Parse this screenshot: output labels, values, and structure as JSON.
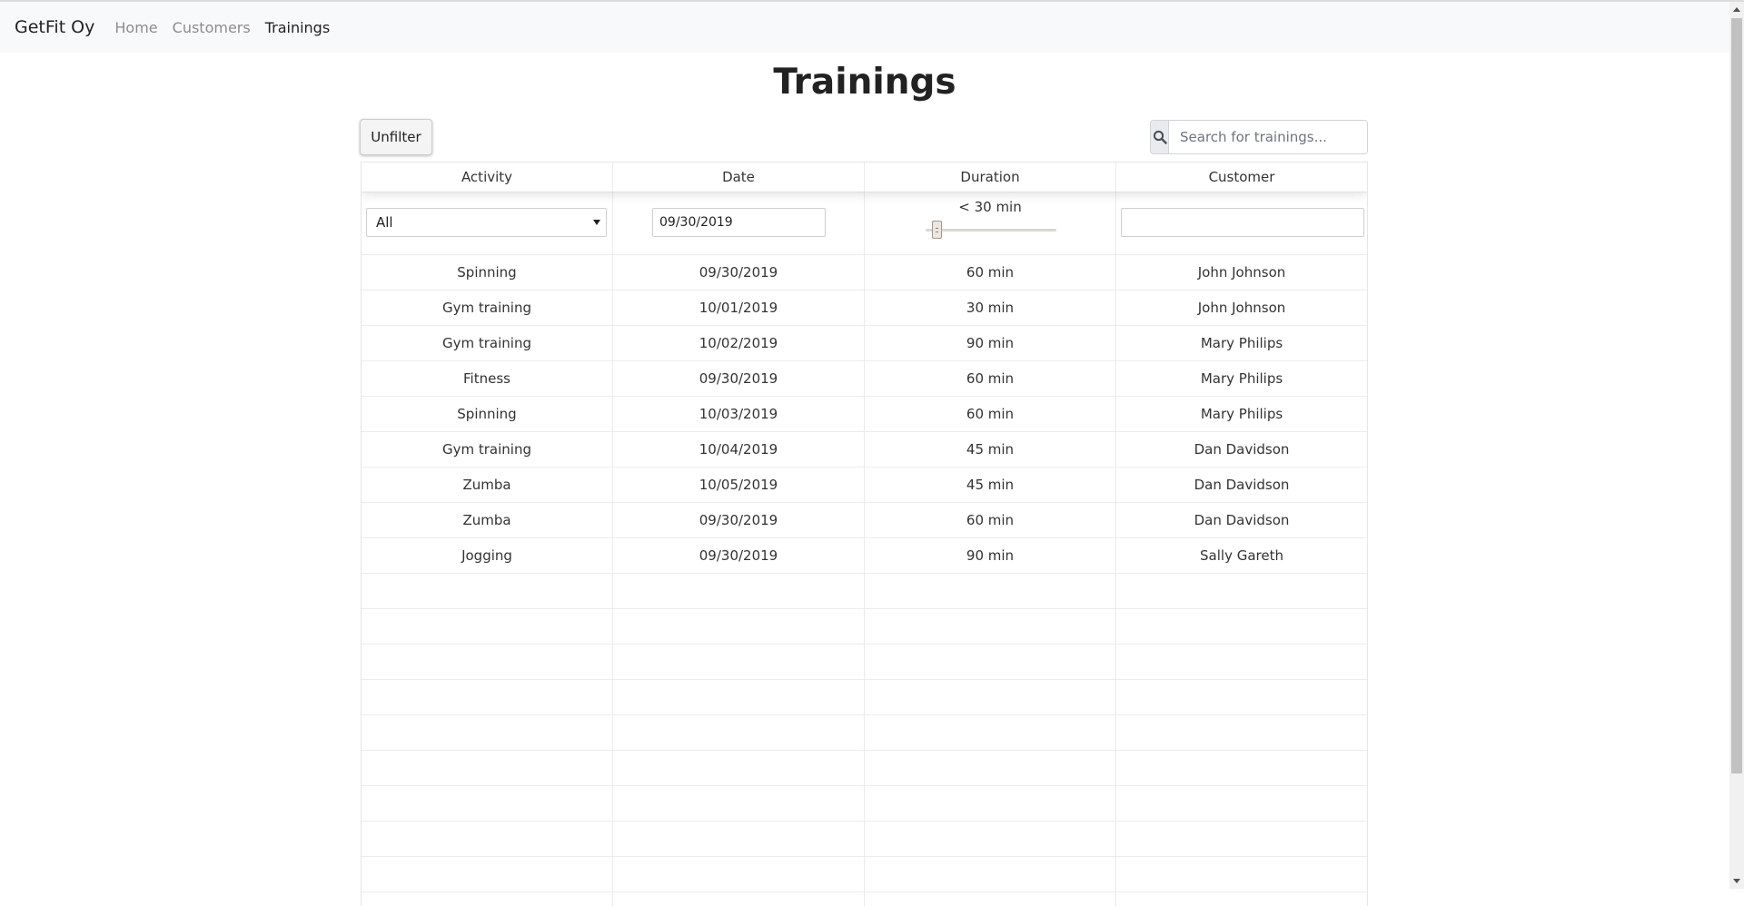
{
  "navbar": {
    "brand": "GetFit Oy",
    "links": [
      {
        "label": "Home",
        "active": false
      },
      {
        "label": "Customers",
        "active": false
      },
      {
        "label": "Trainings",
        "active": true
      }
    ]
  },
  "page": {
    "title": "Trainings"
  },
  "toolbar": {
    "unfilter_label": "Unfilter",
    "search_icon": "search-icon",
    "search_placeholder": "Search for trainings..."
  },
  "table": {
    "columns": [
      "Activity",
      "Date",
      "Duration",
      "Customer"
    ],
    "filters": {
      "activity_selected": "All",
      "date_value": "09/30/2019",
      "duration_label": "< 30 min",
      "duration_slider_fraction": 0.1,
      "customer_value": ""
    },
    "rows": [
      [
        "Spinning",
        "09/30/2019",
        "60 min",
        "John Johnson"
      ],
      [
        "Gym training",
        "10/01/2019",
        "30 min",
        "John Johnson"
      ],
      [
        "Gym training",
        "10/02/2019",
        "90 min",
        "Mary Philips"
      ],
      [
        "Fitness",
        "09/30/2019",
        "60 min",
        "Mary Philips"
      ],
      [
        "Spinning",
        "10/03/2019",
        "60 min",
        "Mary Philips"
      ],
      [
        "Gym training",
        "10/04/2019",
        "45 min",
        "Dan Davidson"
      ],
      [
        "Zumba",
        "10/05/2019",
        "45 min",
        "Dan Davidson"
      ],
      [
        "Zumba",
        "09/30/2019",
        "60 min",
        "Dan Davidson"
      ],
      [
        "Jogging",
        "09/30/2019",
        "90 min",
        "Sally Gareth"
      ]
    ]
  }
}
